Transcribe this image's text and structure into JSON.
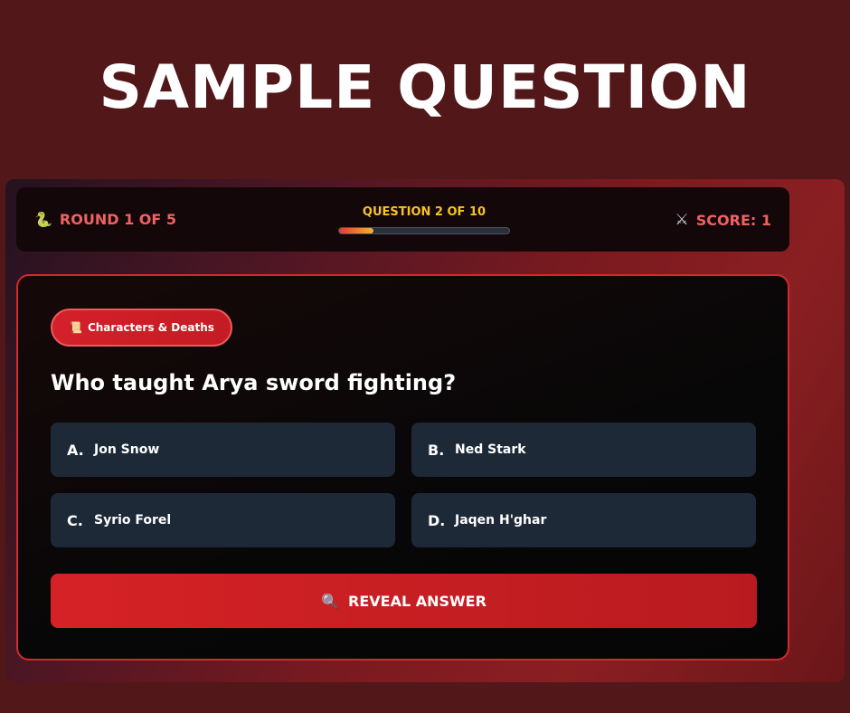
{
  "headline": "SAMPLE QUESTION",
  "topbar": {
    "round_icon": "serpent-icon",
    "round_label": "ROUND 1 OF 5",
    "question_label": "QUESTION 2 OF 10",
    "progress_fraction": 0.2,
    "score_icon": "crossed-swords-icon",
    "score_label": "SCORE: 1"
  },
  "card": {
    "category_icon": "scroll-icon",
    "category_label": "Characters & Deaths",
    "question": "Who taught Arya sword fighting?",
    "options": [
      {
        "letter": "A.",
        "text": "Jon Snow"
      },
      {
        "letter": "B.",
        "text": "Ned Stark"
      },
      {
        "letter": "C.",
        "text": "Syrio Forel"
      },
      {
        "letter": "D.",
        "text": "Jaqen H'ghar"
      }
    ],
    "reveal_icon": "magnifier-icon",
    "reveal_label": "REVEAL ANSWER"
  },
  "colors": {
    "background": "#521719",
    "accent_red": "#d62226",
    "round_score_text": "#f06262",
    "question_counter": "#f8c424",
    "option_bg": "#1e2937"
  }
}
